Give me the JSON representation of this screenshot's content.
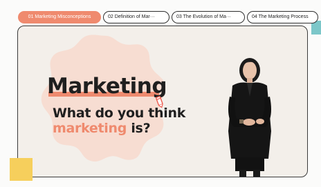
{
  "tabs": [
    {
      "label": "01 Marketing Misconceptions",
      "active": true
    },
    {
      "label": "02 Definition of  Mar···",
      "active": false
    },
    {
      "label": "03 The Evolution of Ma···",
      "active": false
    },
    {
      "label": "04 The Marketing Process",
      "active": false
    }
  ],
  "slide": {
    "heading": "Marketing",
    "question_line1": "What do you think",
    "question_accent": "marketing",
    "question_rest": " is?"
  },
  "colors": {
    "accent": "#ef8a6e",
    "blob": "#f7ddd2",
    "teal": "#7cc7c9",
    "yellow": "#f6cf5c"
  }
}
